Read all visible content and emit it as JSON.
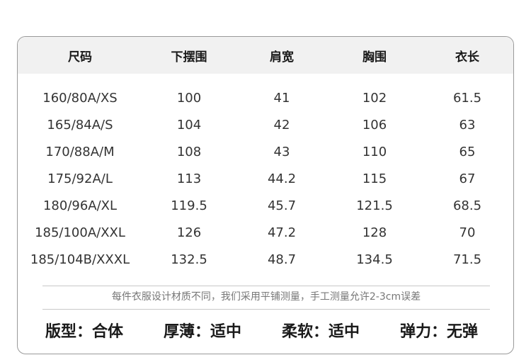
{
  "table": {
    "headers": [
      "尺码",
      "下摆围",
      "肩宽",
      "胸围",
      "衣长"
    ],
    "rows": [
      [
        "160/80A/XS",
        "100",
        "41",
        "102",
        "61.5"
      ],
      [
        "165/84A/S",
        "104",
        "42",
        "106",
        "63"
      ],
      [
        "170/88A/M",
        "108",
        "43",
        "110",
        "65"
      ],
      [
        "175/92A/L",
        "113",
        "44.2",
        "115",
        "67"
      ],
      [
        "180/96A/XL",
        "119.5",
        "45.7",
        "121.5",
        "68.5"
      ],
      [
        "185/100A/XXL",
        "126",
        "47.2",
        "128",
        "70"
      ],
      [
        "185/104B/XXXL",
        "132.5",
        "48.7",
        "134.5",
        "71.5"
      ]
    ]
  },
  "note": "每件衣服设计材质不同，我们采用平铺测量，手工测量允许2-3cm误差",
  "features": [
    "版型：合体",
    "厚薄：适中",
    "柔软：适中",
    "弹力：无弹"
  ]
}
